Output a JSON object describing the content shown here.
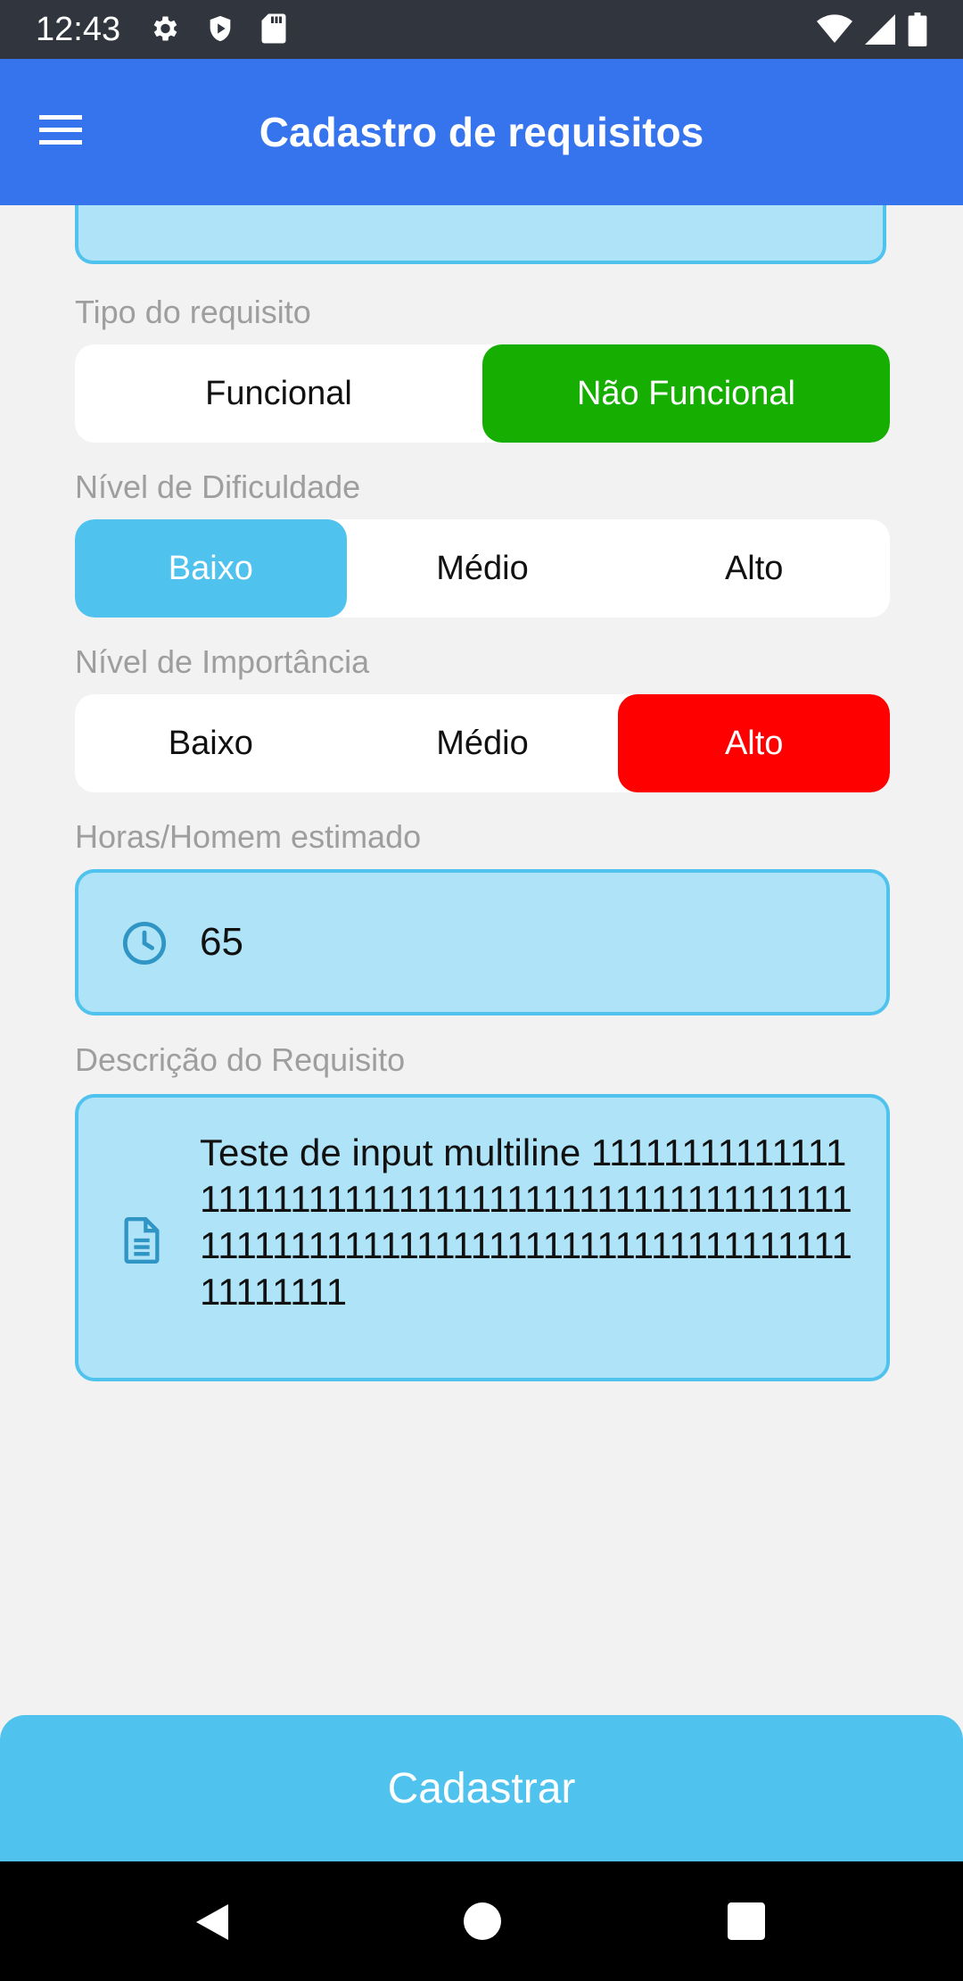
{
  "status_bar": {
    "time": "12:43",
    "left_icons": [
      "gear-icon",
      "shield-icon",
      "sd-card-icon"
    ],
    "right_icons": [
      "wifi-icon",
      "cell-signal-icon",
      "battery-icon"
    ]
  },
  "app_bar": {
    "title": "Cadastro de requisitos",
    "menu_icon": "hamburger-menu-icon",
    "color": "#3674ee"
  },
  "form": {
    "tipo": {
      "label": "Tipo do requisito",
      "options": [
        "Funcional",
        "Não Funcional"
      ],
      "selected": "Não Funcional",
      "selected_color": "#16ae00"
    },
    "dificuldade": {
      "label": "Nível de Dificuldade",
      "options": [
        "Baixo",
        "Médio",
        "Alto"
      ],
      "selected": "Baixo",
      "selected_color": "#4fc2ee"
    },
    "importancia": {
      "label": "Nível de Importância",
      "options": [
        "Baixo",
        "Médio",
        "Alto"
      ],
      "selected": "Alto",
      "selected_color": "#ff0000"
    },
    "horas": {
      "label": "Horas/Homem estimado",
      "value": "65",
      "icon": "clock-icon"
    },
    "descricao": {
      "label": "Descrição do Requisito",
      "value": "Teste de input multiline 1111111111111111111111111111111111111111111111111111111111111111111111111111111111111111111111",
      "icon": "document-icon"
    }
  },
  "submit": {
    "label": "Cadastrar",
    "color": "#4fc2ee"
  },
  "nav_bar": {
    "icons": [
      "back-icon",
      "home-icon",
      "recents-icon"
    ]
  }
}
